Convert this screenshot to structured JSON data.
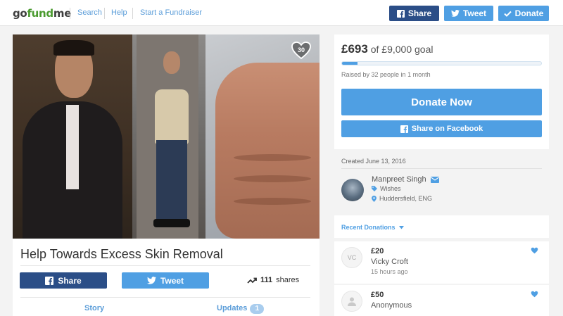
{
  "header": {
    "logo": {
      "go": "go",
      "fund": "fund",
      "me": "me"
    },
    "nav": [
      "Search",
      "Help",
      "Start a Fundraiser"
    ],
    "share_label": "Share",
    "tweet_label": "Tweet",
    "donate_label": "Donate"
  },
  "campaign": {
    "heart_count": "30",
    "title": "Help Towards Excess Skin Removal",
    "share_label": "Share",
    "tweet_label": "Tweet",
    "shares_count": "111",
    "shares_label": "shares",
    "tabs": [
      {
        "label": "Story"
      },
      {
        "label": "Updates",
        "count": "1"
      }
    ]
  },
  "goal": {
    "raised": "£693",
    "goal_text": "of £9,000 goal",
    "progress_fraction": 0.077,
    "raised_by": "Raised by 32 people in 1 month",
    "donate_now": "Donate Now",
    "share_facebook": "Share on Facebook"
  },
  "organizer": {
    "created": "Created June 13, 2016",
    "name": "Manpreet Singh",
    "category": "Wishes",
    "location": "Huddersfield, ENG"
  },
  "recent": {
    "label": "Recent Donations",
    "items": [
      {
        "initials": "VC",
        "amount": "£20",
        "name": "Vicky Croft",
        "time": "15 hours ago"
      },
      {
        "initials": "",
        "amount": "£50",
        "name": "Anonymous",
        "time": ""
      }
    ]
  },
  "colors": {
    "brand_green": "#4a9a2f",
    "facebook_blue": "#2b4e87",
    "accent_blue": "#4f9fe3"
  }
}
